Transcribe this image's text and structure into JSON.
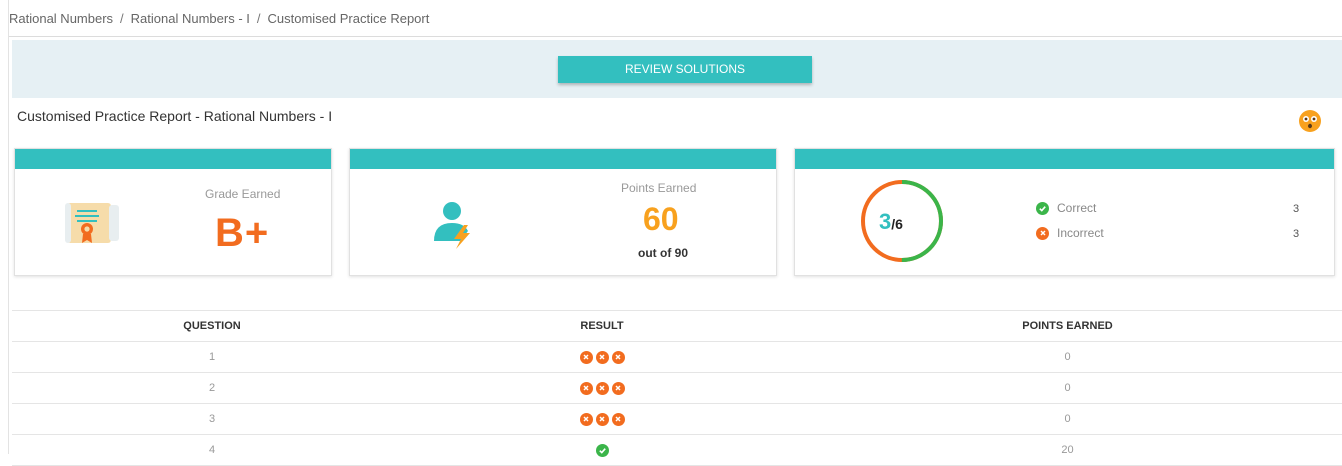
{
  "breadcrumb": {
    "items": [
      "Rational Numbers",
      "Rational Numbers - I",
      "Customised Practice Report"
    ],
    "separator": "/"
  },
  "banner": {
    "review_button_label": "REVIEW SOLUTIONS"
  },
  "report": {
    "title": "Customised Practice Report - Rational Numbers - I"
  },
  "grade_card": {
    "label": "Grade Earned",
    "grade": "B+",
    "icon": "certificate-icon"
  },
  "points_card": {
    "label": "Points Earned",
    "points": "60",
    "out_of": "out of 90",
    "icon": "user-bolt-icon"
  },
  "score_card": {
    "correct_num": "3",
    "total_num": "/6",
    "correct_fraction": 0.5,
    "legend": [
      {
        "label": "Correct",
        "count": "3",
        "icon": "check-circle-icon",
        "color": "#3bb54a"
      },
      {
        "label": "Incorrect",
        "count": "3",
        "icon": "x-circle-icon",
        "color": "#f26c1f"
      }
    ]
  },
  "table": {
    "headers": [
      "QUESTION",
      "RESULT",
      "POINTS EARNED"
    ],
    "rows": [
      {
        "question": "1",
        "result": [
          "incorrect",
          "incorrect",
          "incorrect"
        ],
        "points": "0"
      },
      {
        "question": "2",
        "result": [
          "incorrect",
          "incorrect",
          "incorrect"
        ],
        "points": "0"
      },
      {
        "question": "3",
        "result": [
          "incorrect",
          "incorrect",
          "incorrect"
        ],
        "points": "0"
      },
      {
        "question": "4",
        "result": [
          "correct"
        ],
        "points": "20"
      }
    ]
  },
  "colors": {
    "accent": "#33bfbf",
    "orange": "#f26c1f",
    "gold": "#f8a11e",
    "green": "#3bb54a"
  }
}
